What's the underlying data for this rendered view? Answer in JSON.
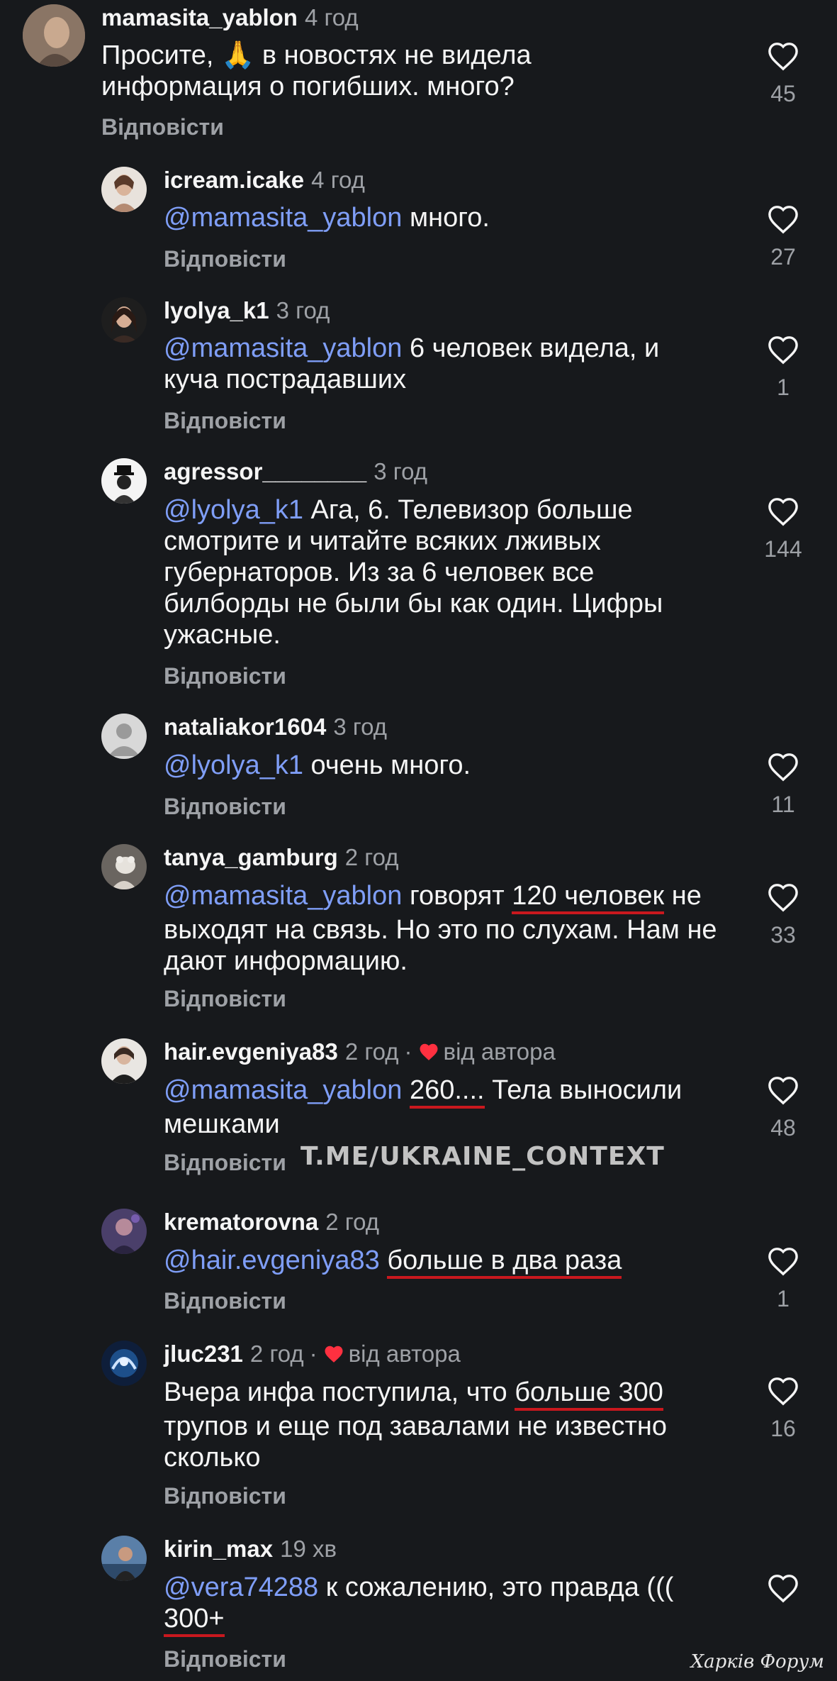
{
  "reply_label": "Відповісти",
  "from_author_label": "від автора",
  "watermark": "T.ME/UKRAINE_CONTEXT",
  "forum_mark": "Харків Форум",
  "colors": {
    "background": "#17191c",
    "mention": "#7f9ef7",
    "muted": "#9ea1a6",
    "underline": "#c9181e",
    "heart_red": "#ff3040"
  },
  "comments": [
    {
      "username": "mamasita_yablon",
      "time": "4 год",
      "text_a": "Просите, ",
      "emoji": "🙏",
      "text_b": " в новостях не видела информация о погибших. много?",
      "likes": "45"
    },
    {
      "username": "icream.icake",
      "time": "4 год",
      "mention": "@mamasita_yablon",
      "text": " много.",
      "likes": "27"
    },
    {
      "username": "lyolya_k1",
      "time": "3 год",
      "mention": "@mamasita_yablon",
      "text": " 6 человек  видела, и куча пострадавших",
      "likes": "1"
    },
    {
      "username": "agressor________",
      "time": "3 год",
      "mention": "@lyolya_k1",
      "text": " Ага, 6. Телевизор больше смотрите и читайте всяких лживых губернаторов. Из за 6 человек все билборды не были бы как один. Цифры ужасные.",
      "likes": "144"
    },
    {
      "username": "nataliakor1604",
      "time": "3 год",
      "mention": "@lyolya_k1",
      "text": " очень много.",
      "likes": "11"
    },
    {
      "username": "tanya_gamburg",
      "time": "2 год",
      "mention": "@mamasita_yablon",
      "text_a": " говорят ",
      "underlined": "120 человек",
      "text_b": " не выходят на связь. Но это по слухам. Нам не дают информацию.",
      "likes": "33"
    },
    {
      "username": "hair.evgeniya83",
      "time": "2 год",
      "from_author": true,
      "mention": "@mamasita_yablon",
      "text_a": " ",
      "underlined": "260....",
      "text_b": " Тела выносили мешками",
      "likes": "48"
    },
    {
      "username": "krematorovna",
      "time": "2 год",
      "mention": "@hair.evgeniya83",
      "text_a": " ",
      "underlined": "больше в два раза",
      "text_b": "",
      "likes": "1"
    },
    {
      "username": "jluc231",
      "time": "2 год",
      "from_author": true,
      "text_a": "Вчера инфа поступила, что ",
      "underlined": "больше 300",
      "text_b": " трупов и еще под завалами не известно сколько",
      "likes": "16"
    },
    {
      "username": "kirin_max",
      "time": "19 хв",
      "mention": "@vera74288",
      "text_a": " к сожалению, это правда ((( ",
      "underlined": "300+",
      "text_b": "",
      "likes": ""
    }
  ]
}
